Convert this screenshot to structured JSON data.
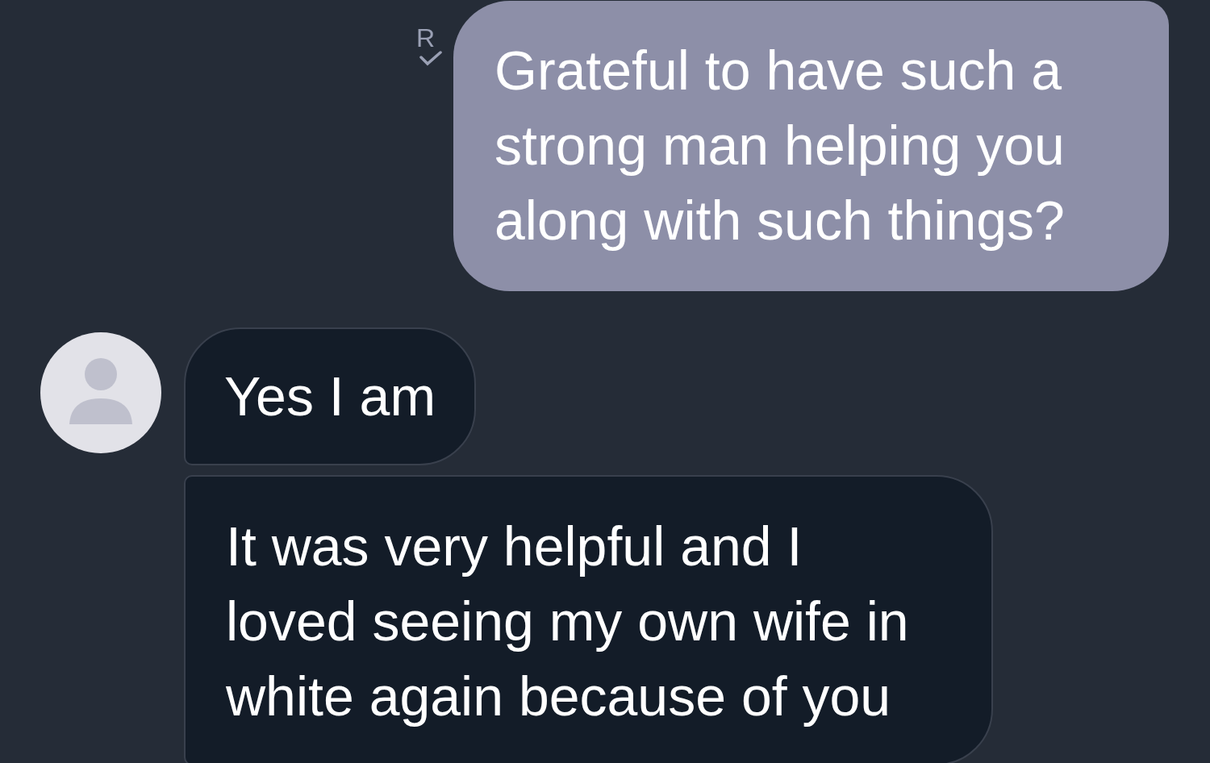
{
  "messages": [
    {
      "kind": "outgoing",
      "read_mark": "R",
      "text": "Grateful to have such a\nstrong man helping you\nalong with such things?"
    },
    {
      "kind": "incoming",
      "avatar": true,
      "text": "Yes I am"
    },
    {
      "kind": "incoming",
      "avatar": false,
      "text": "It was very helpful and I\nloved seeing my own wife in\nwhite again because of you"
    }
  ]
}
